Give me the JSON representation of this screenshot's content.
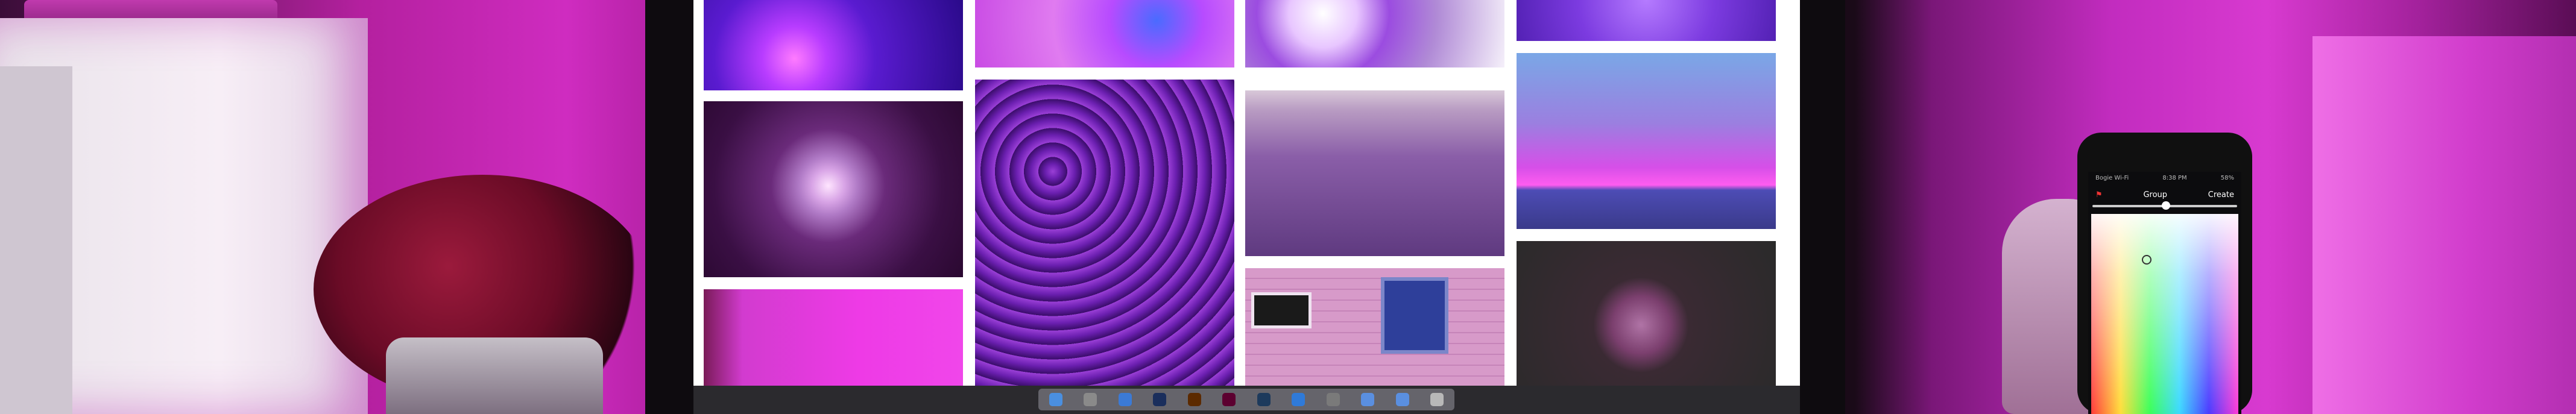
{
  "photo": {
    "phone": {
      "status_left": "Bogie Wi-Fi",
      "status_center": "8:38 PM",
      "status_right": "58%",
      "title": "Group",
      "action": "Create"
    }
  },
  "icons": [
    "flag-icon",
    "photoshop-icon",
    "illustrator-icon",
    "lightroom-icon",
    "finder-icon",
    "trash-icon"
  ]
}
